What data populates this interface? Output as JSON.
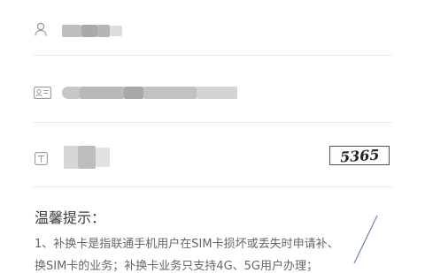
{
  "form": {
    "user_field": {
      "icon": "user-icon",
      "value": ""
    },
    "id_field": {
      "icon": "id-card-icon",
      "value": ""
    },
    "captcha_field": {
      "icon": "text-t-icon",
      "value": "",
      "captcha_text": "5365"
    }
  },
  "tips": {
    "title": "温馨提示：",
    "line1": "1、补换卡是指联通手机用户在SIM卡损坏或丢失时申请补、",
    "line2": "换SIM卡的业务；补换卡业务只支持4G、5G用户办理；"
  },
  "colors": {
    "divider": "#e6e6e6",
    "icon": "#9a9a9a",
    "tip_text": "#666666"
  }
}
